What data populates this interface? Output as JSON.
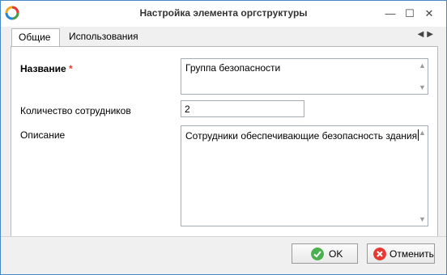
{
  "window": {
    "title": "Настройка элемента оргструктуры",
    "controls": {
      "minimize": "—",
      "maximize": "☐",
      "close": "✕"
    }
  },
  "tabs": [
    {
      "label": "Общие",
      "active": true
    },
    {
      "label": "Использования",
      "active": false
    }
  ],
  "tab_nav": {
    "prev": "◀",
    "next": "▶"
  },
  "form": {
    "name": {
      "label": "Название",
      "required_mark": "*",
      "value": "Группа безопасности"
    },
    "employee_count": {
      "label": "Количество сотрудников",
      "value": "2"
    },
    "description": {
      "label": "Описание",
      "value": "Сотрудники обеспечивающие безопасность здания"
    }
  },
  "buttons": {
    "ok": {
      "label": "OK",
      "icon": "check-icon",
      "color": "#4caf50"
    },
    "cancel": {
      "label": "Отменить",
      "icon": "close-circle-icon",
      "color": "#e53935"
    }
  },
  "colors": {
    "window_border": "#4a87c7",
    "required": "#e53935"
  }
}
